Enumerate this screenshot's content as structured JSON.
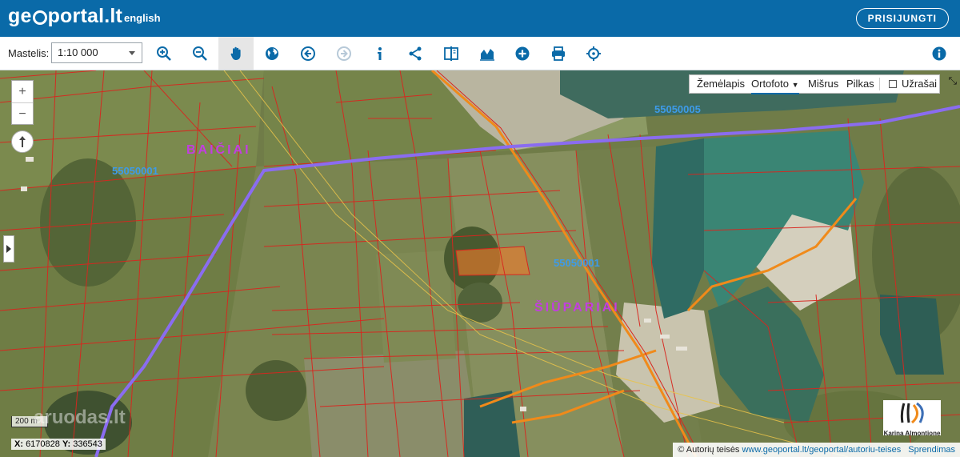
{
  "header": {
    "logo_text_pre": "ge",
    "logo_text_post": "portal.lt",
    "language_link": "english",
    "login_button": "PRISIJUNGTI"
  },
  "toolbar": {
    "scale_label": "Mastelis:",
    "scale_value": "1:10 000",
    "tools": [
      {
        "name": "zoom-in-icon",
        "icon": "magnifier-plus"
      },
      {
        "name": "zoom-out-icon",
        "icon": "magnifier-minus"
      },
      {
        "name": "pan-hand-icon",
        "icon": "hand",
        "active": true
      },
      {
        "name": "globe-icon",
        "icon": "globe"
      },
      {
        "name": "back-arrow-icon",
        "icon": "arrow-left-circle"
      },
      {
        "name": "forward-arrow-icon",
        "icon": "arrow-right-circle",
        "disabled": true
      },
      {
        "name": "info-icon",
        "icon": "info"
      },
      {
        "name": "share-icon",
        "icon": "share"
      },
      {
        "name": "compare-icon",
        "icon": "split-view"
      },
      {
        "name": "elevation-profile-icon",
        "icon": "area-chart"
      },
      {
        "name": "add-icon",
        "icon": "plus-circle"
      },
      {
        "name": "print-icon",
        "icon": "printer"
      },
      {
        "name": "locate-icon",
        "icon": "crosshair"
      }
    ],
    "help_icon": "info-circle"
  },
  "map": {
    "zoom_in": "+",
    "zoom_out": "−",
    "basemaps": [
      "Žemėlapis",
      "Ortofoto",
      "Mišrus",
      "Pilkas"
    ],
    "active_basemap": "Ortofoto",
    "labels_toggle": "Užrašai",
    "labels_checked": false,
    "place_labels": [
      "BAIČIAI",
      "ŠIŪPARIAI"
    ],
    "cadastral_labels": [
      "55050001",
      "55050005",
      "55050001"
    ],
    "scale_bar": "200 m",
    "coordinates": {
      "x_label": "X:",
      "x": "6170828",
      "y_label": "Y:",
      "y": "336543"
    },
    "watermark": "aruodas.lt",
    "brand": "Karina Almontione",
    "copyright_text": "© Autorių teisės",
    "copyright_link": "www.geoportal.lt/geoportal/autoriu-teises",
    "sprendimas_link": "Sprendimas",
    "colors": {
      "header": "#0a6aa8",
      "parcel_lines": "#d8261f",
      "road_orange": "#f08a1a",
      "boundary_purple": "#8a6cf0",
      "village_label": "#c23ee0",
      "cadastre_label": "#3d9be9",
      "water": "#3d7a63",
      "highlight_parcel": "#e87a2b"
    }
  }
}
